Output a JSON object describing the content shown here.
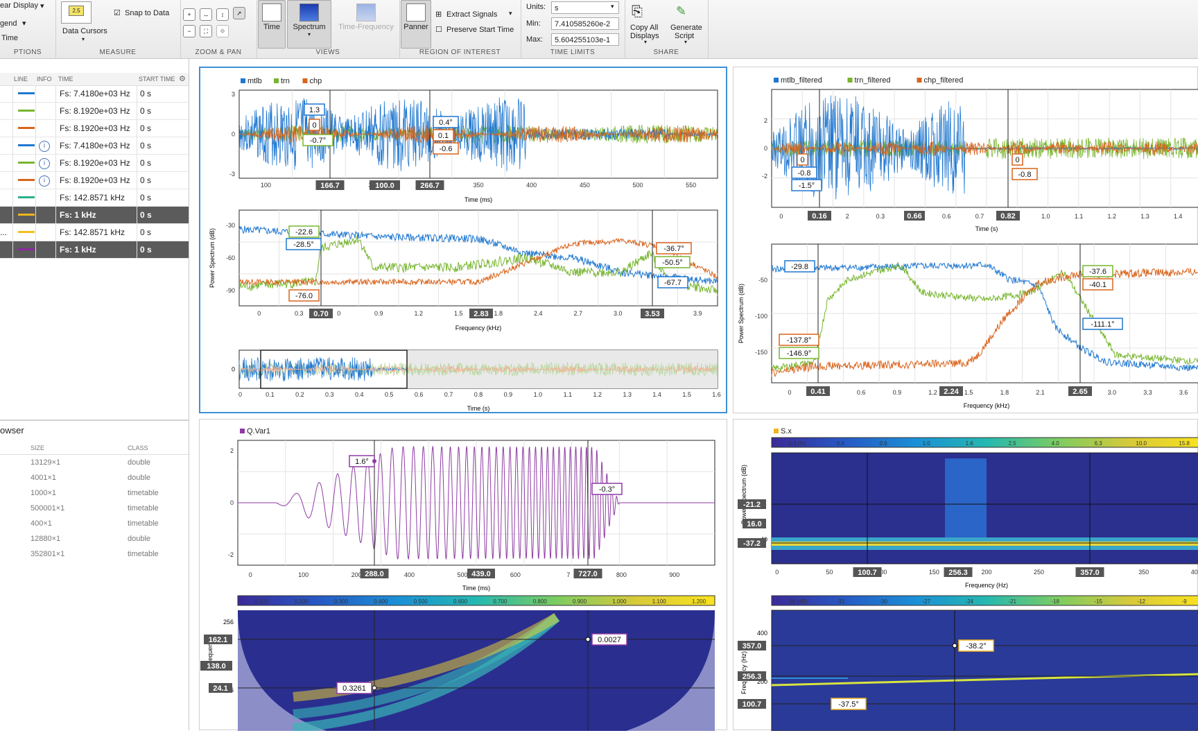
{
  "toolstrip": {
    "options": {
      "label": "PTIONS",
      "items": [
        "ear Display",
        "gend",
        "Time"
      ]
    },
    "measure": {
      "label": "MEASURE",
      "cursor_value": "2.5",
      "data_cursors": "Data Cursors",
      "snap_to_data": "Snap to Data"
    },
    "zoom_pan": {
      "label": "ZOOM & PAN"
    },
    "views": {
      "label": "VIEWS",
      "time": "Time",
      "spectrum": "Spectrum",
      "time_frequency": "Time-Frequency"
    },
    "roi": {
      "label": "REGION OF INTEREST",
      "panner": "Panner",
      "extract_signals": "Extract Signals",
      "preserve_start_time": "Preserve Start Time"
    },
    "time_limits": {
      "label": "TIME LIMITS",
      "units_label": "Units:",
      "units_value": "s",
      "min_label": "Min:",
      "min_value": "7.410585260e-2",
      "max_label": "Max:",
      "max_value": "5.604255103e-1"
    },
    "share": {
      "label": "SHARE",
      "copy_all": "Copy All",
      "displays": "Displays",
      "generate": "Generate",
      "script": "Script"
    }
  },
  "signal_table": {
    "headers": [
      "LINE",
      "INFO",
      "TIME",
      "START TIME"
    ],
    "rows": [
      {
        "color": "#1f77d0",
        "info": false,
        "time": "Fs: 7.4180e+03 Hz",
        "start": "0 s",
        "dark": false
      },
      {
        "color": "#77b52e",
        "info": false,
        "time": "Fs: 8.1920e+03 Hz",
        "start": "0 s",
        "dark": false
      },
      {
        "color": "#d9641c",
        "info": false,
        "time": "Fs: 8.1920e+03 Hz",
        "start": "0 s",
        "dark": false
      },
      {
        "color": "#1f77d0",
        "info": true,
        "time": "Fs: 7.4180e+03 Hz",
        "start": "0 s",
        "dark": false
      },
      {
        "color": "#77b52e",
        "info": true,
        "time": "Fs: 8.1920e+03 Hz",
        "start": "0 s",
        "dark": false
      },
      {
        "color": "#d9641c",
        "info": true,
        "time": "Fs: 8.1920e+03 Hz",
        "start": "0 s",
        "dark": false
      },
      {
        "color": "#2cae8c",
        "info": false,
        "time": "Fs: 142.8571 kHz",
        "start": "0 s",
        "dark": false
      },
      {
        "color": "#f0b51c",
        "info": false,
        "time": "Fs: 1 kHz",
        "start": "0 s",
        "dark": true
      },
      {
        "color": "#f0c020",
        "info": false,
        "time": "Fs: 142.8571 kHz",
        "start": "0 s",
        "dark": false,
        "prefix": "..."
      },
      {
        "color": "#8a2b9e",
        "info": false,
        "time": "Fs: 1 kHz",
        "start": "0 s",
        "dark": true
      }
    ]
  },
  "browser": {
    "title": "owser",
    "headers": [
      "SIZE",
      "CLASS"
    ],
    "rows": [
      {
        "size": "13129×1",
        "class": "double"
      },
      {
        "size": "4001×1",
        "class": "double"
      },
      {
        "size": "1000×1",
        "class": "timetable"
      },
      {
        "size": "500001×1",
        "class": "timetable"
      },
      {
        "size": "400×1",
        "class": "timetable"
      },
      {
        "size": "12880×1",
        "class": "double"
      },
      {
        "size": "352801×1",
        "class": "timetable"
      }
    ]
  },
  "panel_tl": {
    "legend": [
      "mtlb",
      "trn",
      "chp"
    ],
    "time_plot": {
      "xlabel": "Time (ms)",
      "xticks": [
        "100",
        "15",
        "25",
        "300",
        "350",
        "400",
        "450",
        "500",
        "550"
      ],
      "yticks": [
        "3",
        "0",
        "-3"
      ],
      "cursors": [
        "166.7",
        "100.0",
        "266.7"
      ],
      "labels": [
        "1.3",
        "0",
        "-0.7°",
        "0.4°",
        "0.1",
        "-0.6"
      ]
    },
    "spec_plot": {
      "xlabel": "Frequency (kHz)",
      "ylabel": "Power Spectrum (dB)",
      "xticks": [
        "0",
        "0.3",
        "0",
        "0.9",
        "1.2",
        "1.5",
        "1.8",
        "2.4",
        "2.7",
        "3.0",
        "3.3",
        "3.9"
      ],
      "yticks": [
        "-30",
        "-60",
        "-90"
      ],
      "cursors": [
        "0.70",
        "2.83",
        "3.53"
      ],
      "labels": [
        "-22.6",
        "-28.5°",
        "-76.0",
        "-36.7°",
        "-50.5°",
        "-67.7"
      ]
    },
    "panner": {
      "xlabel": "Time (s)",
      "ytick": "0",
      "xticks": [
        "0",
        "0.1",
        "0.2",
        "0.3",
        "0.4",
        "0.5",
        "0.6",
        "0.7",
        "0.8",
        "0.9",
        "1.0",
        "1.1",
        "1.2",
        "1.3",
        "1.4",
        "1.5",
        "1.6"
      ]
    }
  },
  "panel_tr": {
    "legend": [
      "mtlb_filtered",
      "trn_filtered",
      "chp_filtered"
    ],
    "time_plot": {
      "xlabel": "Time (s)",
      "xticks": [
        "0",
        "0.1",
        "2",
        "0.3",
        "0.4",
        "0.6",
        "0.7",
        "0.9",
        "1.0",
        "1.1",
        "1.2",
        "1.3",
        "1.4"
      ],
      "yticks": [
        "2",
        "0",
        "-2"
      ],
      "cursors": [
        "0.16",
        "0.66",
        "0.82"
      ],
      "labels": [
        "0",
        "-0.8",
        "-1.5°",
        "0",
        "-0.8"
      ]
    },
    "spec_plot": {
      "xlabel": "Frequency (kHz)",
      "ylabel": "Power Spectrum (dB)",
      "xticks": [
        "0",
        "0.3",
        "0.6",
        "0.9",
        "1.2",
        "1.5",
        "1.8",
        "2.1",
        "2.4",
        "3.0",
        "3.3",
        "3.6"
      ],
      "yticks": [
        "-50",
        "-100",
        "-150"
      ],
      "cursors": [
        "0.41",
        "2.24",
        "2.65"
      ],
      "labels": [
        "-29.8",
        "-137.8°",
        "-146.9°",
        "-37.6",
        "-40.1",
        "-111.1°"
      ]
    }
  },
  "panel_bl": {
    "legend": [
      "Q.Var1"
    ],
    "time_plot": {
      "xlabel": "Time (ms)",
      "xticks": [
        "0",
        "100",
        "200",
        "400",
        "500",
        "600",
        "7",
        "800",
        "900"
      ],
      "yticks": [
        "2",
        "0",
        "-2"
      ],
      "cursors": [
        "288.0",
        "439.0",
        "727.0"
      ],
      "labels": [
        "1.6°",
        "-0.3°"
      ]
    },
    "scalogram": {
      "colorbar": [
        "0.100",
        "0.200",
        "0.300",
        "0.400",
        "0.500",
        "0.600",
        "0.700",
        "0.800",
        "0.900",
        "1.000",
        "1.100",
        "1.200"
      ],
      "ylabel": "Frequency",
      "yticks": [
        "256",
        "16"
      ],
      "cursors": [
        "162.1",
        "138.0",
        "24.1"
      ],
      "labels": [
        "0.0027",
        "0.3261"
      ]
    }
  },
  "panel_br": {
    "legend": [
      "S.x"
    ],
    "colorbar_top": [
      "0.3 (%)",
      "0.4",
      "0.6",
      "1.0",
      "1.6",
      "2.5",
      "4.0",
      "6.3",
      "10.0",
      "15.8"
    ],
    "spec_plot": {
      "xlabel": "Frequency (Hz)",
      "ylabel": "Power Spectrum (dB)",
      "xticks": [
        "0",
        "50",
        "100",
        "150",
        "200",
        "250",
        "300",
        "350",
        "400"
      ],
      "yticks": [
        "-40"
      ],
      "cursors": [
        "100.7",
        "256.3",
        "357.0"
      ],
      "ycursors": [
        "-21.2",
        "16.0",
        "-37.2"
      ]
    },
    "colorbar_bottom": [
      "-36 (dB)",
      "-33",
      "-30",
      "-27",
      "-24",
      "-21",
      "-18",
      "-15",
      "-12",
      "-9"
    ],
    "spectrogram": {
      "ylabel": "Frequency (Hz)",
      "yticks": [
        "400",
        "200"
      ],
      "ycursors": [
        "357.0",
        "256.3",
        "100.7"
      ],
      "labels": [
        "-38.2°",
        "-37.5°"
      ]
    }
  }
}
